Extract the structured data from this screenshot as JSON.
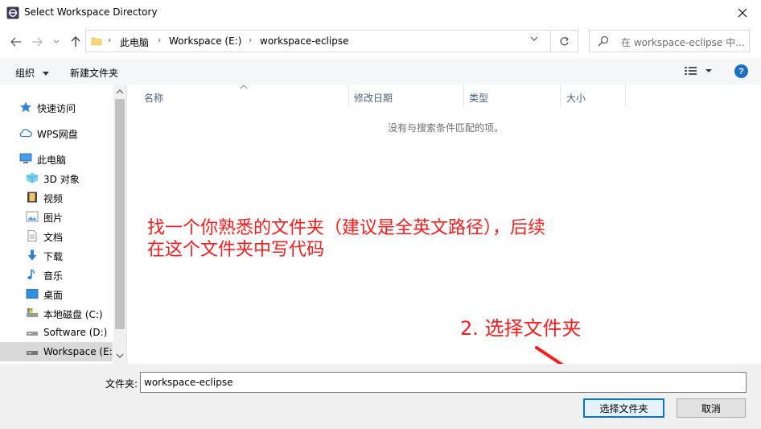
{
  "window": {
    "title": "Select Workspace Directory"
  },
  "address": {
    "crumbs": [
      "此电脑",
      "Workspace (E:)",
      "workspace-eclipse"
    ]
  },
  "search": {
    "placeholder": "在 workspace-eclipse 中..."
  },
  "toolbar": {
    "organize_label": "组织",
    "new_folder_label": "新建文件夹",
    "help_label": "?"
  },
  "sidebar": {
    "items": [
      {
        "label": "快速访问",
        "icon": "star-icon"
      },
      {
        "label": "WPS网盘",
        "icon": "cloud-icon"
      },
      {
        "label": "此电脑",
        "icon": "computer-icon"
      },
      {
        "label": "3D 对象",
        "icon": "cube-icon"
      },
      {
        "label": "视频",
        "icon": "video-icon"
      },
      {
        "label": "图片",
        "icon": "picture-icon"
      },
      {
        "label": "文档",
        "icon": "document-icon"
      },
      {
        "label": "下载",
        "icon": "download-icon"
      },
      {
        "label": "音乐",
        "icon": "music-icon"
      },
      {
        "label": "桌面",
        "icon": "desktop-icon"
      },
      {
        "label": "本地磁盘 (C:)",
        "icon": "drive-icon"
      },
      {
        "label": "Software (D:)",
        "icon": "drive-icon"
      },
      {
        "label": "Workspace (E:)",
        "icon": "drive-icon"
      }
    ]
  },
  "columns": [
    "名称",
    "修改日期",
    "类型",
    "大小"
  ],
  "empty_message": "没有与搜索条件匹配的项。",
  "annotations": {
    "instruction_line1": "找一个你熟悉的文件夹（建议是全英文路径），后续",
    "instruction_line2": "在这个文件夹中写代码",
    "step": "2. 选择文件夹",
    "color": "#ff1a1a"
  },
  "footer": {
    "folder_label": "文件夹:",
    "folder_value": "workspace-eclipse",
    "select_button": "选择文件夹",
    "cancel_button": "取消"
  },
  "colors": {
    "accent": "#0078d7",
    "selected_bg": "#d9d9d9"
  }
}
